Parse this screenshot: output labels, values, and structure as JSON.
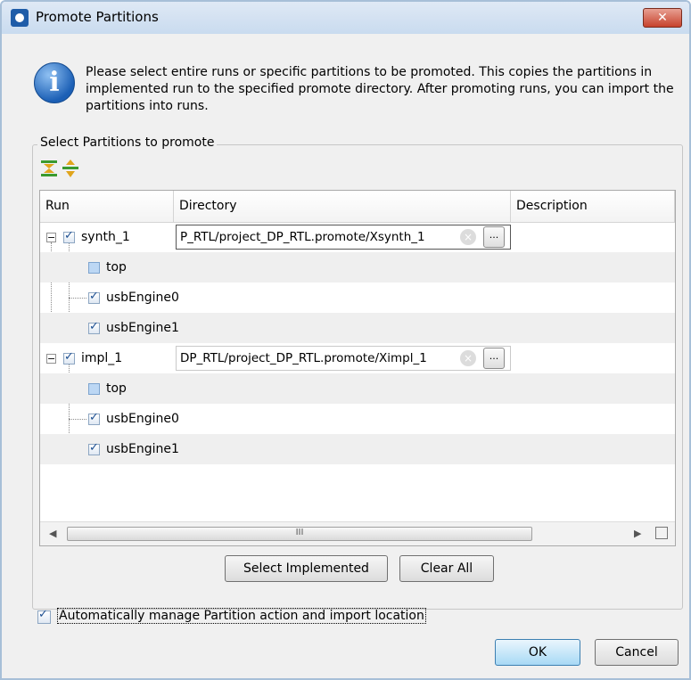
{
  "window": {
    "title": "Promote Partitions",
    "close_label": "✕"
  },
  "info": {
    "icon": "info-icon",
    "message": "Please select entire runs or specific partitions to be promoted. This copies the partitions in implemented run to the specified promote directory. After promoting runs, you can import the partitions into runs."
  },
  "group": {
    "label": "Select Partitions to promote"
  },
  "toolbar": {
    "collapse_icon": "collapse-all-icon",
    "expand_icon": "expand-all-icon"
  },
  "table": {
    "columns": [
      "Run",
      "Directory",
      "Description"
    ],
    "rows": [
      {
        "label": "synth_1",
        "checked": true,
        "directory": "P_RTL/project_DP_RTL.promote/Xsynth_1",
        "browse": "..."
      },
      {
        "label": "top",
        "checked": false
      },
      {
        "label": "usbEngine0",
        "checked": true
      },
      {
        "label": "usbEngine1",
        "checked": true
      },
      {
        "label": "impl_1",
        "checked": true,
        "directory": "DP_RTL/project_DP_RTL.promote/Ximpl_1",
        "browse": "..."
      },
      {
        "label": "top",
        "checked": false
      },
      {
        "label": "usbEngine0",
        "checked": true
      },
      {
        "label": "usbEngine1",
        "checked": true
      }
    ],
    "scrollbar": {
      "thumb_grip": "III",
      "left_arrow": "◀",
      "right_arrow": "▶"
    }
  },
  "buttons": {
    "select_implemented": "Select Implemented",
    "clear_all": "Clear All",
    "ok": "OK",
    "cancel": "Cancel"
  },
  "auto_manage": {
    "checked": true,
    "label": "Automatically manage Partition action and import location"
  }
}
